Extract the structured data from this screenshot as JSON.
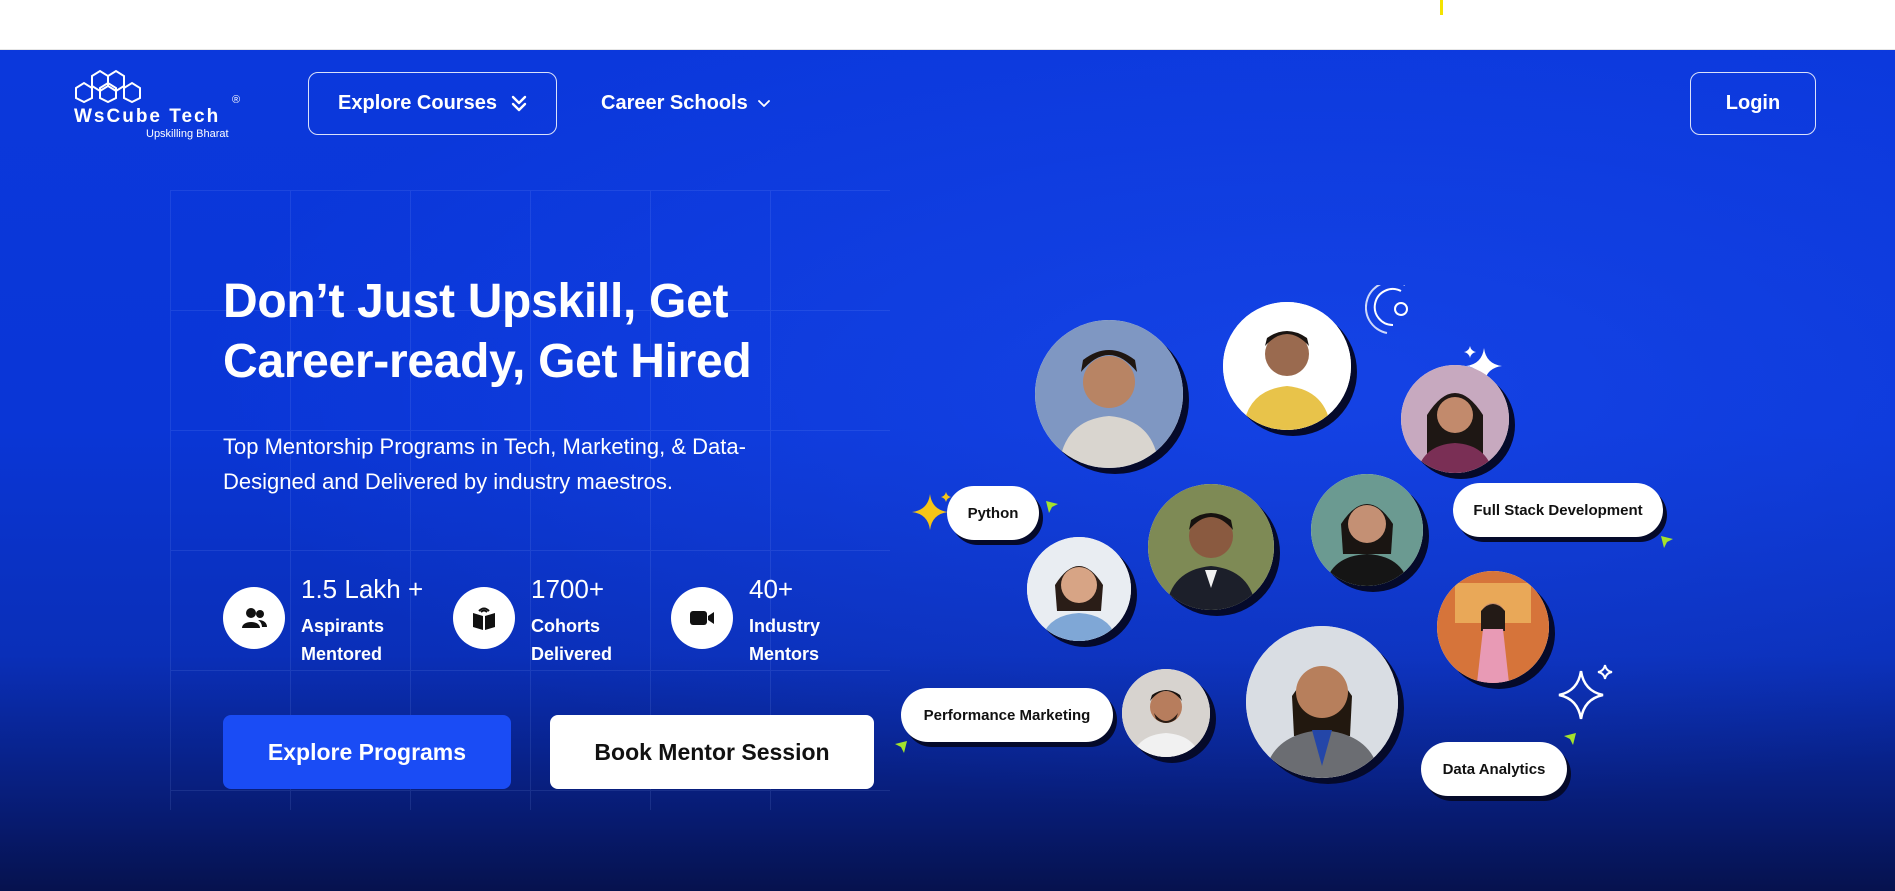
{
  "brand": {
    "name": "WsCube Tech",
    "registered_mark": "®",
    "tagline": "Upskilling Bharat"
  },
  "nav": {
    "explore_courses": "Explore Courses",
    "career_schools": "Career Schools",
    "login": "Login"
  },
  "hero": {
    "headline_line1": "Don’t Just Upskill, Get",
    "headline_line2": "Career-ready, Get Hired",
    "subtext_line1": "Top Mentorship Programs in Tech, Marketing, & Data-",
    "subtext_line2": "Designed and Delivered by industry maestros.",
    "stats": [
      {
        "icon": "users-icon",
        "value": "1.5 Lakh +",
        "label_line1": "Aspirants",
        "label_line2": "Mentored"
      },
      {
        "icon": "book-icon",
        "value": "1700+",
        "label_line1": "Cohorts",
        "label_line2": "Delivered"
      },
      {
        "icon": "video-camera-icon",
        "value": "40+",
        "label_line1": "Industry",
        "label_line2": "Mentors"
      }
    ],
    "primary_button": "Explore Programs",
    "secondary_button": "Book Mentor Session"
  },
  "collage": {
    "pills": [
      "Python",
      "Full Stack Development",
      "Performance Marketing",
      "Data Analytics"
    ]
  },
  "colors": {
    "hero_blue": "#0a36d6",
    "primary_button": "#1a4cf5",
    "accent_star": "#f5c518",
    "accent_green": "#a4e22c",
    "top_marker": "#f4e300"
  }
}
